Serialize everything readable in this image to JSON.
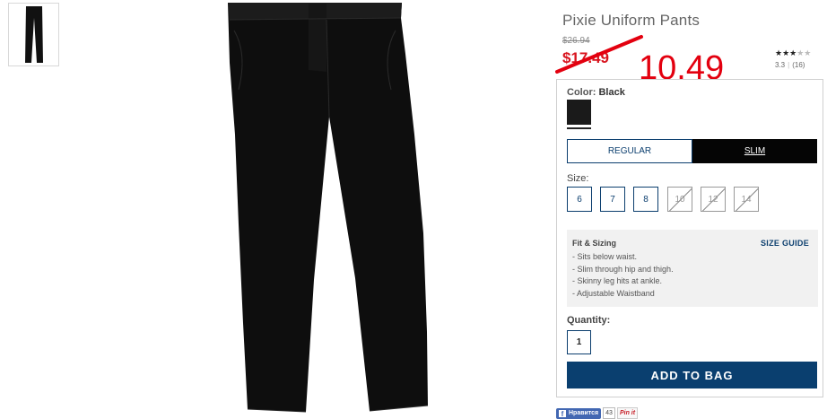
{
  "product": {
    "title": "Pixie Uniform Pants",
    "old_price": "$26.94",
    "sale_price": "$17.49",
    "new_price": "10.49",
    "rating_value": "3.3",
    "review_count": "(16)",
    "stars_filled": "★★★",
    "stars_empty": "★★",
    "rating_stars": 3
  },
  "color": {
    "label": "Color:",
    "value": "Black",
    "swatch_color": "#1a1a1a"
  },
  "fit": {
    "regular_label": "REGULAR",
    "slim_label": "SLIM",
    "selected": "SLIM"
  },
  "sizes": {
    "label": "Size:",
    "options": [
      {
        "label": "6",
        "available": true
      },
      {
        "label": "7",
        "available": true
      },
      {
        "label": "8",
        "available": true
      },
      {
        "label": "10",
        "available": false
      },
      {
        "label": "12",
        "available": false
      },
      {
        "label": "14",
        "available": false
      }
    ]
  },
  "fit_sizing": {
    "title": "Fit & Sizing",
    "size_guide": "SIZE GUIDE",
    "bullets": [
      "- Sits below waist.",
      "- Slim through hip and thigh.",
      "- Skinny leg hits at ankle.",
      "- Adjustable Waistband"
    ]
  },
  "quantity": {
    "label": "Quantity:",
    "value": "1"
  },
  "cart": {
    "add_label": "ADD TO BAG"
  },
  "social": {
    "fb_label": "Нравится",
    "fb_count": "43",
    "pin_label": "Pin it"
  },
  "colors": {
    "accent_blue": "#0a3f6f",
    "sale_red": "#d8131d",
    "annotation_red": "#e3000f"
  }
}
